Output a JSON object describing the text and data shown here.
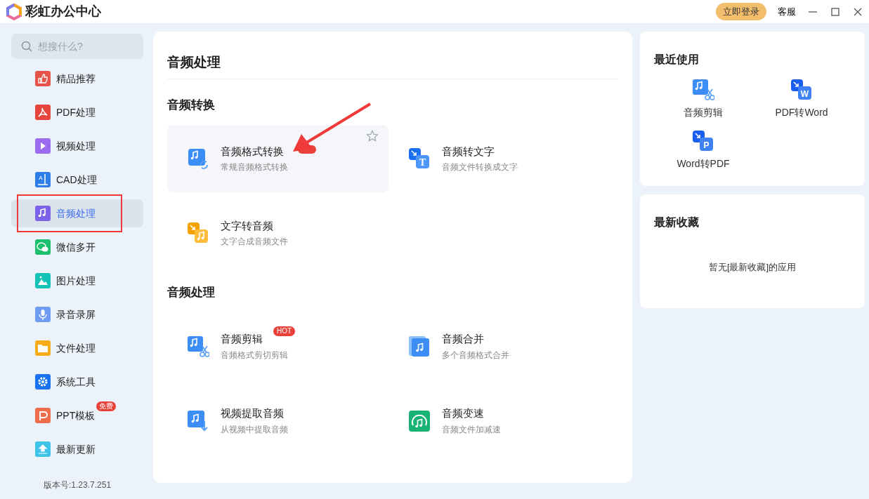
{
  "window": {
    "title": "彩虹办公中心",
    "login_button": "立即登录",
    "service_link": "客服"
  },
  "sidebar": {
    "search": {
      "placeholder": "想搜什么?"
    },
    "items": [
      {
        "label": "精品推荐",
        "selected": false
      },
      {
        "label": "PDF处理",
        "selected": false
      },
      {
        "label": "视频处理",
        "selected": false
      },
      {
        "label": "CAD处理",
        "selected": false,
        "icon_text": "A"
      },
      {
        "label": "音频处理",
        "selected": true
      },
      {
        "label": "微信多开",
        "selected": false
      },
      {
        "label": "图片处理",
        "selected": false
      },
      {
        "label": "录音录屏",
        "selected": false
      },
      {
        "label": "文件处理",
        "selected": false
      },
      {
        "label": "系统工具",
        "selected": false
      },
      {
        "label": "PPT模板",
        "selected": false,
        "badge": "免费"
      },
      {
        "label": "最新更新",
        "selected": false
      }
    ],
    "version": "版本号:1.23.7.251"
  },
  "main": {
    "title": "音频处理",
    "sections": [
      {
        "title": "音频转换",
        "tools": [
          {
            "title": "音频格式转换",
            "desc": "常规音频格式转换",
            "highlighted": true,
            "badge_covered": true
          },
          {
            "title": "音频转文字",
            "desc": "音频文件转换成文字",
            "highlighted": false,
            "icon_text": "T"
          },
          {
            "title": "文字转音频",
            "desc": "文字合成音频文件",
            "highlighted": false
          }
        ]
      },
      {
        "title": "音频处理",
        "tools": [
          {
            "title": "音频剪辑",
            "desc": "音频格式剪切剪辑",
            "highlighted": false,
            "badge": "HOT"
          },
          {
            "title": "音频合并",
            "desc": "多个音频格式合并",
            "highlighted": false
          },
          {
            "title": "视频提取音频",
            "desc": "从视频中提取音频",
            "highlighted": false
          },
          {
            "title": "音频变速",
            "desc": "音频文件加减速",
            "highlighted": false
          }
        ]
      }
    ]
  },
  "recent": {
    "title": "最近使用",
    "items": [
      {
        "label": "音频剪辑"
      },
      {
        "label": "PDF转Word",
        "icon_text": "W"
      },
      {
        "label": "Word转PDF",
        "icon_text": "P"
      }
    ]
  },
  "favorites": {
    "title": "最新收藏",
    "empty_text": "暂无[最新收藏]的应用"
  },
  "annotations": {
    "highlight_rectangle": true,
    "arrow": true
  }
}
